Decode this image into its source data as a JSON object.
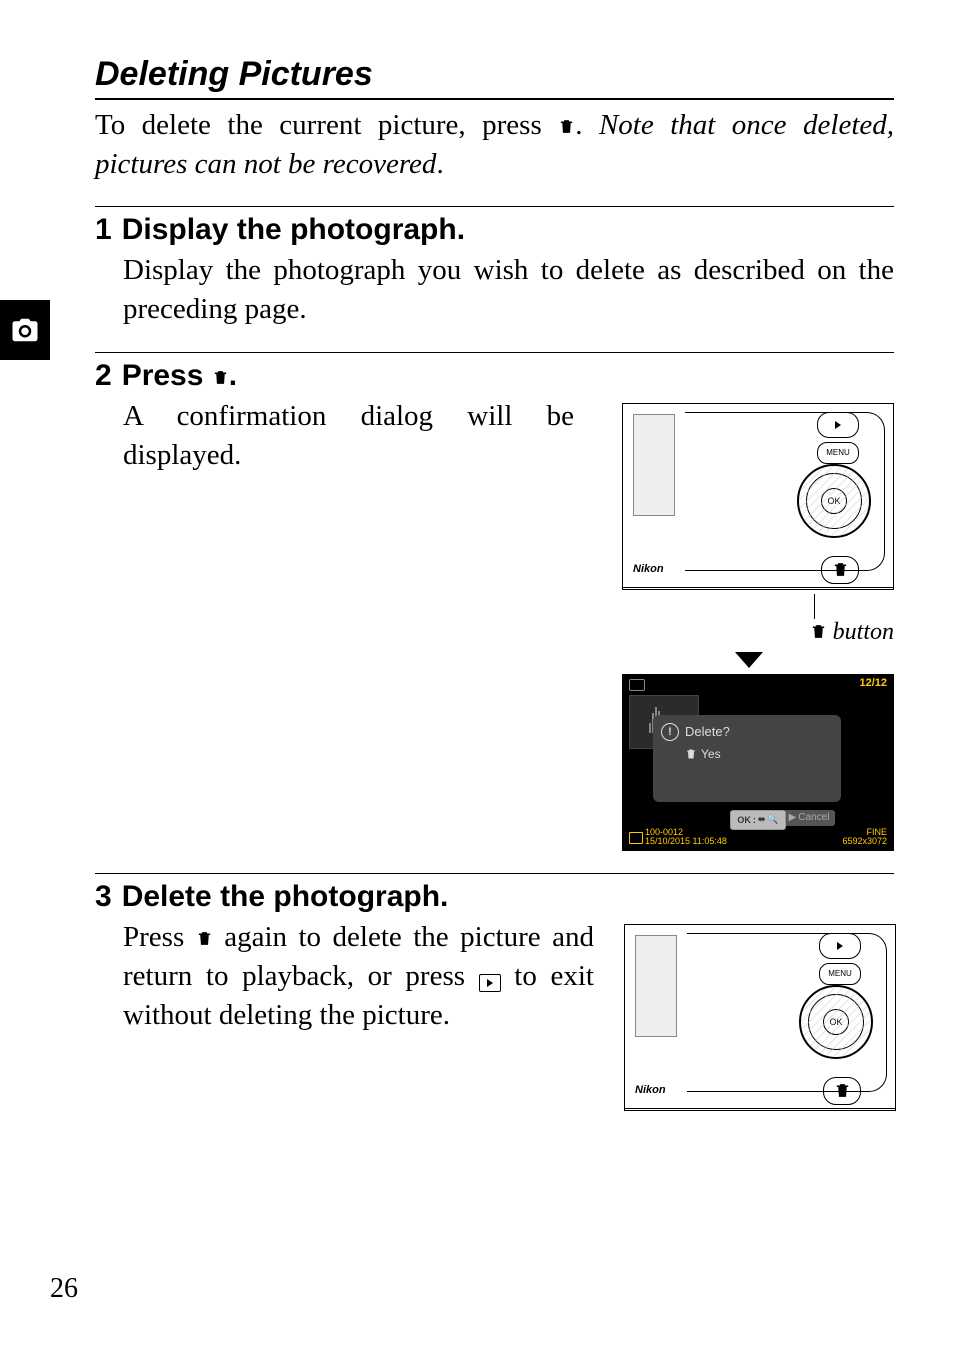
{
  "section_title": "Deleting Pictures",
  "intro_before_icon": "To delete the current picture, press ",
  "intro_after_icon_plain": ". ",
  "intro_note": "Note that once deleted, pictures can not be recovered",
  "intro_end": ".",
  "steps": {
    "s1": {
      "num": "1",
      "title": "Display the photograph.",
      "body": "Display the photograph you wish to delete as described on the preceding page."
    },
    "s2": {
      "num": "2",
      "title_before_icon": "Press ",
      "title_after_icon": ".",
      "body": "A confirmation dialog will be displayed.",
      "fig_caption_after_icon": " button",
      "dialog": {
        "counter": "12/12",
        "delete_label": "Delete?",
        "yes_label": "Yes",
        "cancel_label": "Cancel",
        "ok_label": "OK",
        "file_id": "100-0012",
        "datetime": "15/10/2015 11:05:48",
        "quality": "FINE",
        "size_code": "6592x3072"
      }
    },
    "s3": {
      "num": "3",
      "title": "Delete the photograph.",
      "body_a": "Press ",
      "body_b": " again to delete the picture and return to playback, or press ",
      "body_c": " to exit without deleting the picture."
    }
  },
  "camera": {
    "brand": "Nikon",
    "menu_label": "MENU",
    "ok_label": "OK"
  },
  "page_number": "26"
}
